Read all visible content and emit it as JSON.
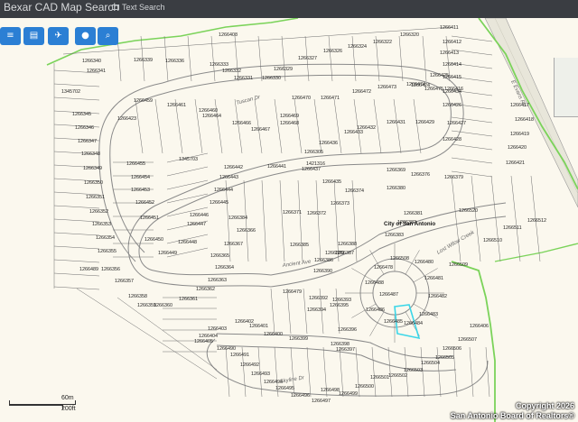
{
  "app": {
    "title": "Bexar CAD Map Search",
    "text_search_label": "Text Search"
  },
  "toolbar": [
    {
      "name": "parcel-tool-button",
      "glyph": "≡"
    },
    {
      "name": "map-layers-button",
      "glyph": "▤"
    },
    {
      "name": "airport-button",
      "glyph": "✈"
    },
    {
      "name": "location-pin-button",
      "glyph": "●"
    },
    {
      "name": "search-button",
      "glyph": "⌕"
    }
  ],
  "map": {
    "road_label": "E Evans Rd",
    "city_label": "City of San Antonio",
    "street_labels": [
      "Tuscan Dr",
      "Ancient Ave",
      "Lost Wilow Creek",
      "Skyline Dr"
    ],
    "parcels": [
      "1266408",
      "1266320",
      "1266411",
      "1266412",
      "1266413",
      "1266414",
      "1266415",
      "1266416",
      "1266417",
      "1266418",
      "1266419",
      "1266420",
      "1266421",
      "1266340",
      "1266341",
      "1345702",
      "1266339",
      "1266336",
      "1266333",
      "1266332",
      "1266331",
      "1266330",
      "1266329",
      "1266327",
      "1266326",
      "1266324",
      "1266322",
      "1266345",
      "1266346",
      "1266347",
      "1266348",
      "1266349",
      "1266350",
      "1266351",
      "1266352",
      "1266353",
      "1266354",
      "1266355",
      "1266356",
      "1266357",
      "1266358",
      "1266359",
      "1266360",
      "1266459",
      "1266461",
      "1266460",
      "1266464",
      "1266466",
      "1266467",
      "1266468",
      "1266469",
      "1266470",
      "1266471",
      "1266472",
      "1266473",
      "1266474",
      "1266475",
      "1266426",
      "1266427",
      "1266428",
      "1266429",
      "1266431",
      "1266432",
      "1266433",
      "1266434",
      "1266425",
      "1266424",
      "1266423",
      "1345703",
      "1266455",
      "1266454",
      "1266453",
      "1266452",
      "1266451",
      "1266450",
      "1266449",
      "1266448",
      "1266447",
      "1266446",
      "1266445",
      "1266444",
      "1266443",
      "1266442",
      "1266441",
      "1421316",
      "1266437",
      "1266305",
      "1266436",
      "1266435",
      "1266374",
      "1266373",
      "1266372",
      "1266371",
      "1266369",
      "1266376",
      "1266379",
      "1266380",
      "1266381",
      "1266382",
      "1266383",
      "1266384",
      "1266366",
      "1266367",
      "1266365",
      "1266364",
      "1266363",
      "1266362",
      "1266361",
      "1266388",
      "1266387",
      "1266386",
      "1266385",
      "1266390",
      "1266389",
      "1266520",
      "1266512",
      "1266511",
      "1266510",
      "1266509",
      "1266508",
      "1266480",
      "1266481",
      "1266482",
      "1266483",
      "1266484",
      "1266485",
      "1266486",
      "1266487",
      "1266488",
      "1266478",
      "1266479",
      "1266392",
      "1266393",
      "1266394",
      "1266395",
      "1266396",
      "1266397",
      "1266398",
      "1266399",
      "1266400",
      "1266401",
      "1266402",
      "1266403",
      "1266404",
      "1266405",
      "1266406",
      "1266507",
      "1266506",
      "1266505",
      "1266504",
      "1266503",
      "1266502",
      "1266501",
      "1266500",
      "1266499",
      "1266498",
      "1266497",
      "1266496",
      "1266495",
      "1266494",
      "1266493",
      "1266492",
      "1266491",
      "1266490",
      "1266489"
    ]
  },
  "scale": {
    "metric": "60m",
    "imperial": "200ft"
  },
  "copyright": {
    "line1": "Copyright 2026",
    "line2": "San Antonio Board of Realtors®"
  },
  "colors": {
    "topbar": "#3a3d42",
    "button": "#2b7fd4",
    "lot_line": "#6e6e6e",
    "selected_parcel": "#3bd6e8",
    "green_boundary": "#7bd35a"
  }
}
